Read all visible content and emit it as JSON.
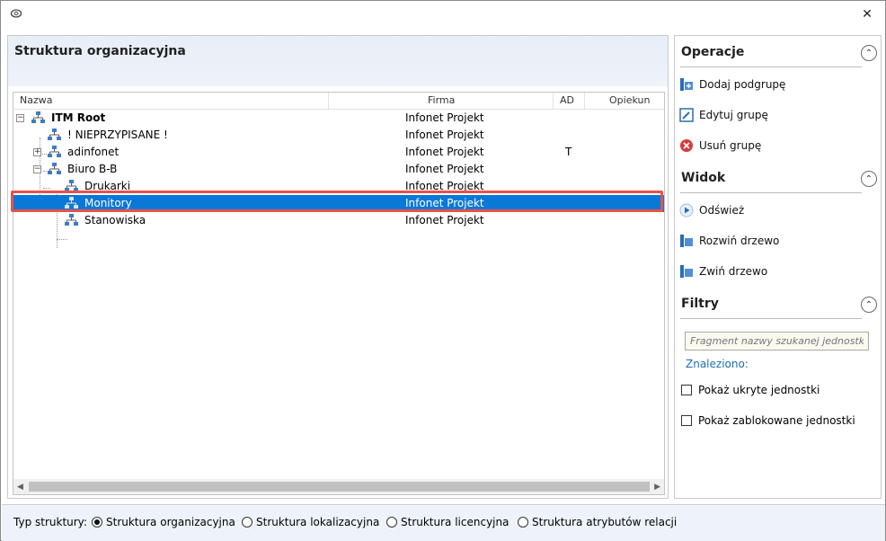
{
  "window": {
    "close_glyph": "✕"
  },
  "left_panel": {
    "title": "Struktura organizacyjna",
    "columns": [
      "Nazwa",
      "Firma",
      "AD",
      "Opiekun"
    ],
    "rows": [
      {
        "name": "ITM Root",
        "firma": "Infonet Projekt",
        "ad": "",
        "opiekun": "",
        "level": 0,
        "expander": "−",
        "bold": true,
        "selected": false
      },
      {
        "name": "! NIEPRZYPISANE !",
        "firma": "Infonet Projekt",
        "ad": "",
        "opiekun": "",
        "level": 1,
        "expander": "",
        "bold": false,
        "selected": false
      },
      {
        "name": "adinfonet",
        "firma": "Infonet Projekt",
        "ad": "T",
        "opiekun": "",
        "level": 1,
        "expander": "+",
        "bold": false,
        "selected": false
      },
      {
        "name": "Biuro B-B",
        "firma": "Infonet Projekt",
        "ad": "",
        "opiekun": "",
        "level": 1,
        "expander": "−",
        "bold": false,
        "selected": false
      },
      {
        "name": "Drukarki",
        "firma": "Infonet Projekt",
        "ad": "",
        "opiekun": "",
        "level": 2,
        "expander": "",
        "bold": false,
        "selected": false
      },
      {
        "name": "Monitory",
        "firma": "Infonet Projekt",
        "ad": "",
        "opiekun": "",
        "level": 2,
        "expander": "",
        "bold": false,
        "selected": true
      },
      {
        "name": "Stanowiska",
        "firma": "Infonet Projekt",
        "ad": "",
        "opiekun": "",
        "level": 2,
        "expander": "",
        "bold": false,
        "selected": false
      }
    ]
  },
  "right_panel": {
    "operations": {
      "title": "Operacje",
      "items": [
        {
          "label": "Dodaj podgrupę",
          "icon": "add-subgroup-icon"
        },
        {
          "label": "Edytuj grupę",
          "icon": "edit-group-icon"
        },
        {
          "label": "Usuń grupę",
          "icon": "delete-group-icon"
        }
      ]
    },
    "view": {
      "title": "Widok",
      "items": [
        {
          "label": "Odśwież",
          "icon": "refresh-icon"
        },
        {
          "label": "Rozwiń drzewo",
          "icon": "expand-tree-icon"
        },
        {
          "label": "Zwiń drzewo",
          "icon": "collapse-tree-icon"
        }
      ]
    },
    "filters": {
      "title": "Filtry",
      "search_placeholder": "Fragment nazwy szukanej jednostki",
      "found_label": "Znaleziono:",
      "checkboxes": [
        {
          "label": "Pokaż ukryte jednostki",
          "checked": false
        },
        {
          "label": "Pokaż zablokowane jednostki",
          "checked": false
        }
      ]
    }
  },
  "bottom_bar": {
    "label": "Typ struktury:",
    "options": [
      {
        "label": "Struktura organizacyjna",
        "selected": true
      },
      {
        "label": "Struktura lokalizacyjna",
        "selected": false
      },
      {
        "label": "Struktura licencyjna",
        "selected": false
      },
      {
        "label": "Struktura atrybutów relacji",
        "selected": false
      }
    ]
  },
  "colors": {
    "selection": "#0a78d7",
    "highlight_border": "#e8524a",
    "link": "#1a6fb4"
  }
}
